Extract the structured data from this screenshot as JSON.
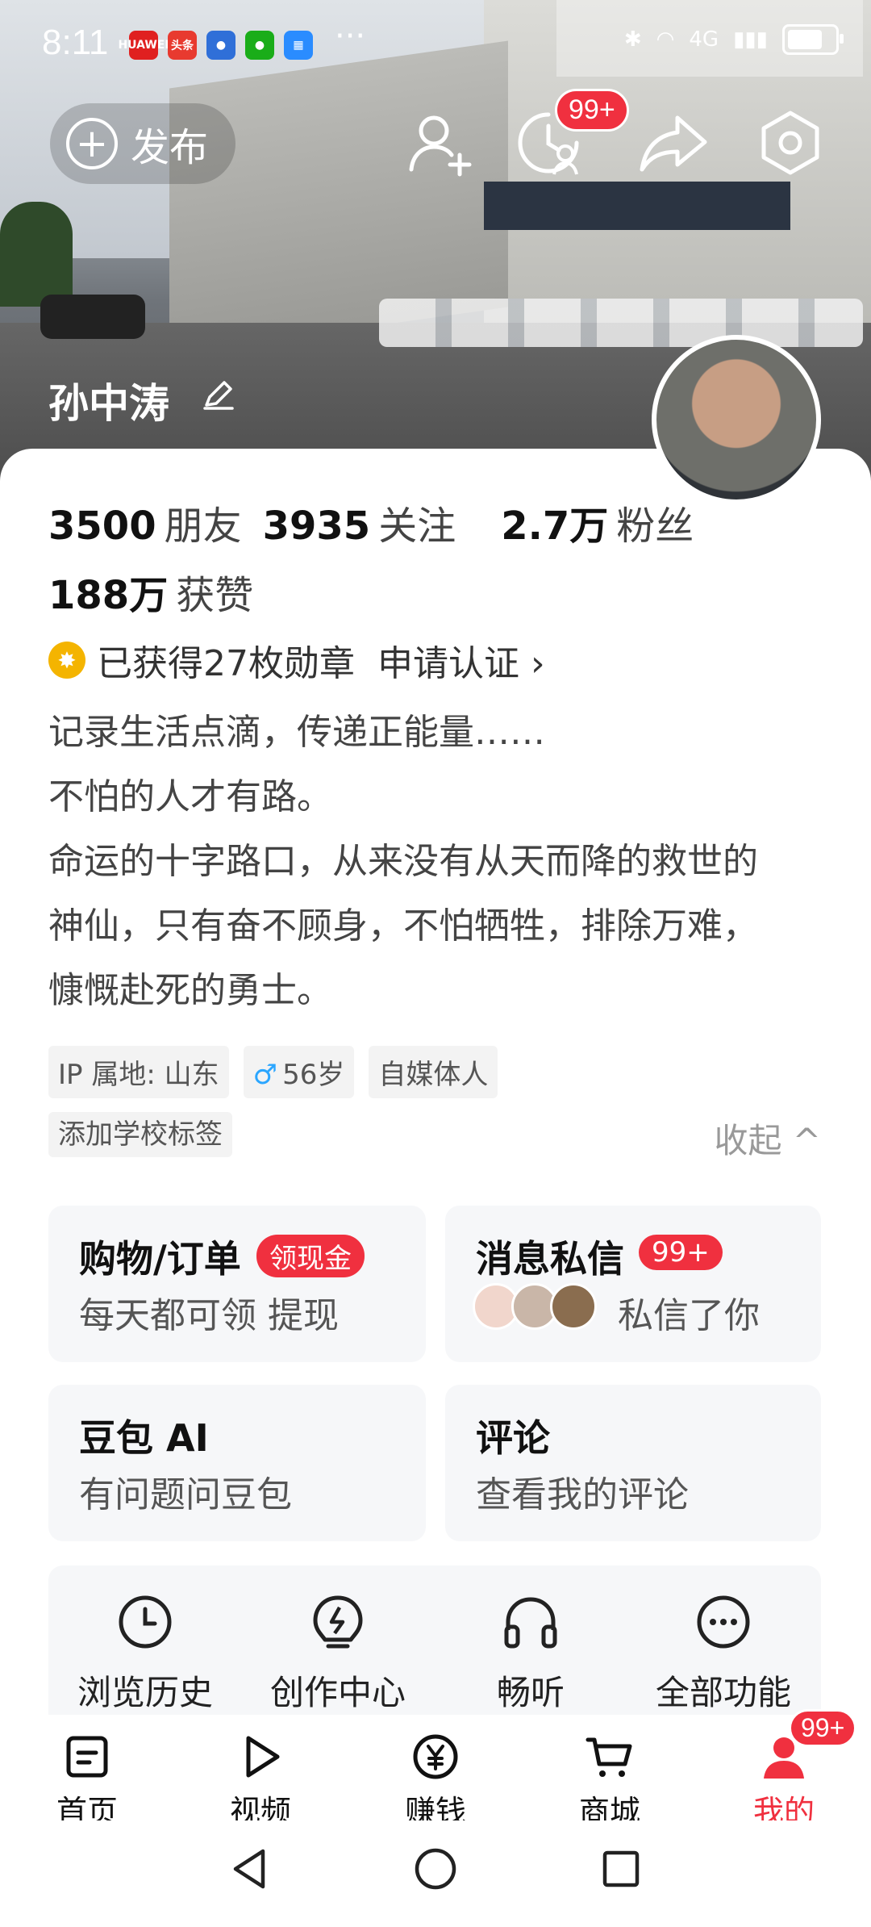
{
  "status_bar": {
    "time": "8:11",
    "dots": "···",
    "network": "4G",
    "app_icons": [
      "HUAWEI",
      "头条",
      "●",
      "●",
      "▦"
    ]
  },
  "header": {
    "publish_label": "发布",
    "badge_count": "99+",
    "username": "孙中涛"
  },
  "stats": [
    {
      "value": "3500",
      "label": "朋友"
    },
    {
      "value": "3935",
      "label": "关注"
    },
    {
      "value": "2.7万",
      "label": "粉丝"
    },
    {
      "value": "188万",
      "label": "获赞"
    }
  ],
  "medals": {
    "text": "已获得27枚勋章",
    "certify": "申请认证 ›"
  },
  "bio": [
    "记录生活点滴，传递正能量……",
    "不怕的人才有路。",
    "命运的十字路口，从来没有从天而降的救世的",
    "神仙，只有奋不顾身，不怕牺牲，排除万难，",
    "慷慨赴死的勇士。"
  ],
  "tags": {
    "ip": "IP 属地: 山东",
    "age": "56岁",
    "role": "自媒体人",
    "school": "添加学校标签",
    "collapse": "收起 ^"
  },
  "cards": {
    "shopping": {
      "title": "购物/订单",
      "pill": "领现金",
      "subtitle": "每天都可领 提现"
    },
    "messages": {
      "title": "消息私信",
      "pill": "99+",
      "subtitle": "私信了你"
    },
    "doubao": {
      "title": "豆包 AI",
      "subtitle": "有问题问豆包"
    },
    "comments": {
      "title": "评论",
      "subtitle": "查看我的评论"
    }
  },
  "tools": [
    {
      "label": "浏览历史",
      "icon": "clock-icon"
    },
    {
      "label": "创作中心",
      "icon": "bulb-icon"
    },
    {
      "label": "畅听",
      "icon": "headphones-icon"
    },
    {
      "label": "全部功能",
      "icon": "more-icon"
    }
  ],
  "nav": [
    {
      "label": "首页",
      "icon": "home-icon"
    },
    {
      "label": "视频",
      "icon": "video-icon"
    },
    {
      "label": "赚钱",
      "icon": "yuan-icon"
    },
    {
      "label": "商城",
      "icon": "cart-icon"
    },
    {
      "label": "我的",
      "icon": "profile-icon",
      "badge": "99+"
    }
  ],
  "colors": {
    "accent": "#f0303f",
    "card_bg": "#f6f7f9",
    "medal": "#f4b400"
  }
}
